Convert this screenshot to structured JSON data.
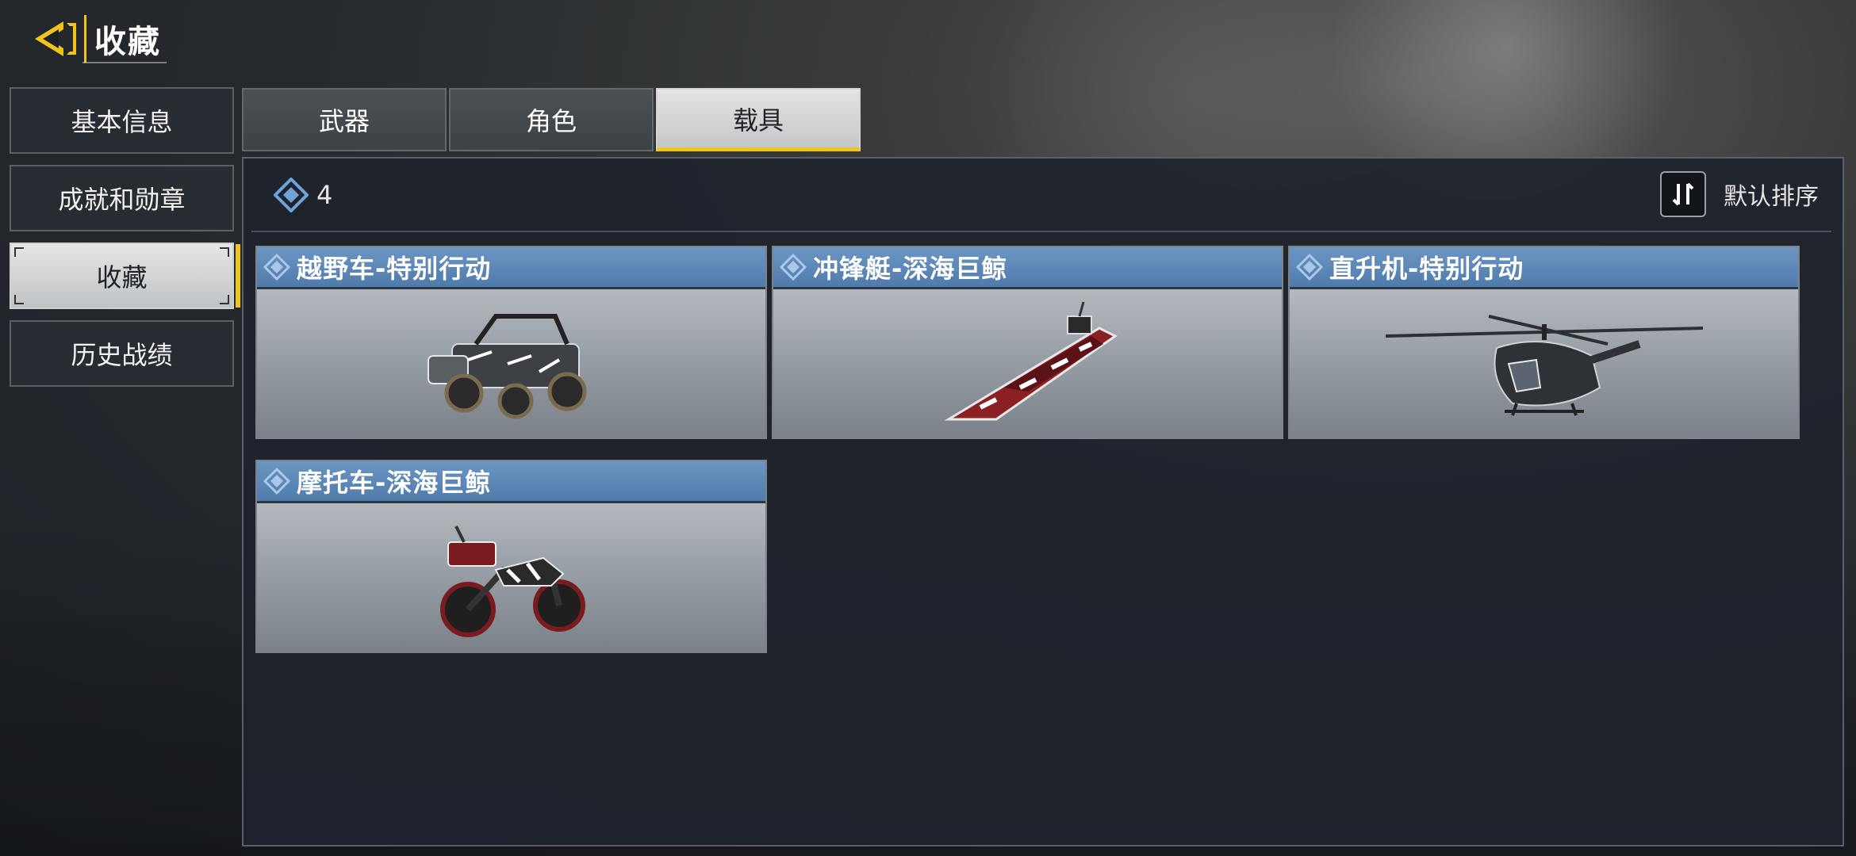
{
  "header": {
    "title": "收藏",
    "back_icon": "back-arrow-icon"
  },
  "sidebar": {
    "items": [
      {
        "label": "基本信息",
        "active": false
      },
      {
        "label": "成就和勋章",
        "active": false
      },
      {
        "label": "收藏",
        "active": true
      },
      {
        "label": "历史战绩",
        "active": false
      }
    ]
  },
  "tabs": [
    {
      "label": "武器",
      "active": false
    },
    {
      "label": "角色",
      "active": false
    },
    {
      "label": "载具",
      "active": true
    }
  ],
  "collection": {
    "count": "4",
    "count_icon": "diamond-icon",
    "sort_icon": "sort-icon",
    "sort_label": "默认排序",
    "items": [
      {
        "name": "越野车-特别行动",
        "icon": "buggy-icon"
      },
      {
        "name": "冲锋艇-深海巨鲸",
        "icon": "speedboat-icon"
      },
      {
        "name": "直升机-特别行动",
        "icon": "helicopter-icon"
      },
      {
        "name": "摩托车-深海巨鲸",
        "icon": "motorcycle-icon"
      }
    ]
  },
  "colors": {
    "accent": "#f0c419",
    "card_title_bg": "#5b87b8",
    "panel_bg": "#1e222c"
  }
}
